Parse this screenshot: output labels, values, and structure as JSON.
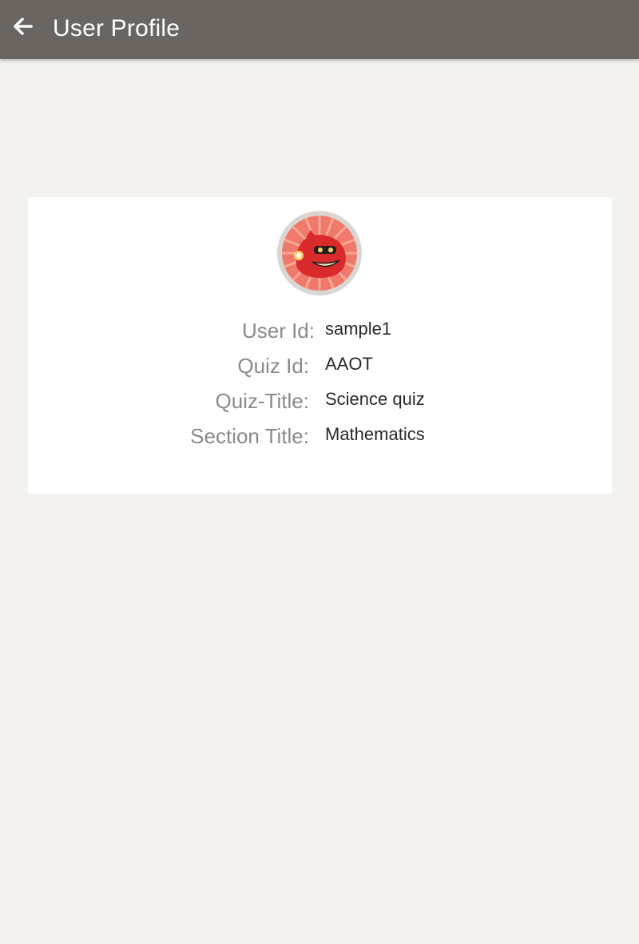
{
  "app_bar": {
    "title": "User Profile",
    "back_icon": "arrow-left-icon",
    "background_color": "#6a6560"
  },
  "profile": {
    "avatar_icon": "cartoon-avatar-icon",
    "fields": [
      {
        "label": "User Id:",
        "value": "sample1"
      },
      {
        "label": "Quiz Id:",
        "value": "AAOT"
      },
      {
        "label": "Quiz-Title:",
        "value": "Science quiz"
      },
      {
        "label": "Section Title:",
        "value": "Mathematics"
      }
    ]
  }
}
